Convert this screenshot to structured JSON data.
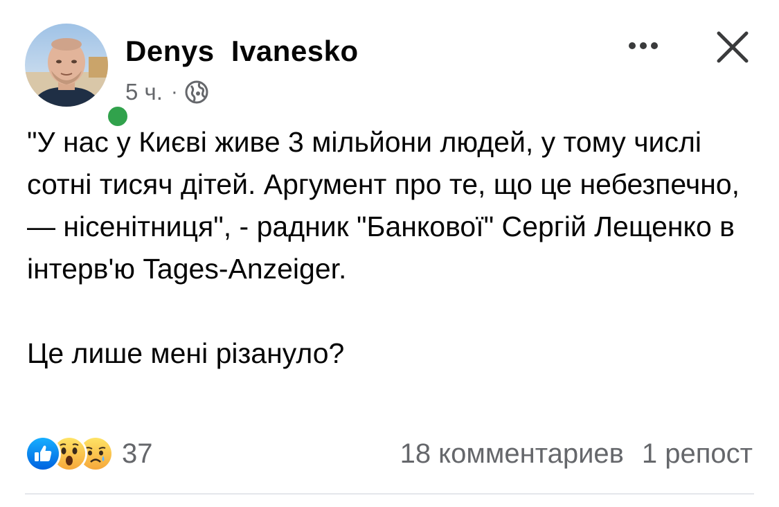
{
  "post": {
    "author": {
      "name": "Denys  Ivanesko",
      "online": true
    },
    "meta": {
      "time": "5 ч.",
      "separator": "·",
      "privacy_icon": "globe-icon"
    },
    "header_actions": {
      "more_icon": "more-dots-icon",
      "close_icon": "close-icon"
    },
    "text": {
      "paragraph_1": "\"У нас у Києві живе 3 мільйони людей, у тому числі сотні тисяч дітей. Аргумент про те, що це небезпечно, — нісенітниця\", - радник \"Банкової\" Сергій Лещенко в інтерв'ю Tages-Anzeiger.",
      "paragraph_2": "Це лише мені різануло?"
    },
    "footer": {
      "reaction_icons": [
        "like-icon",
        "wow-icon",
        "sad-icon"
      ],
      "reaction_count": "37",
      "comments": "18 комментариев",
      "shares": "1 репост"
    }
  },
  "colors": {
    "text_primary": "#050505",
    "text_secondary": "#65676b",
    "online": "#31a24c",
    "like_blue": "#1877f2",
    "divider": "#e4e6eb"
  }
}
